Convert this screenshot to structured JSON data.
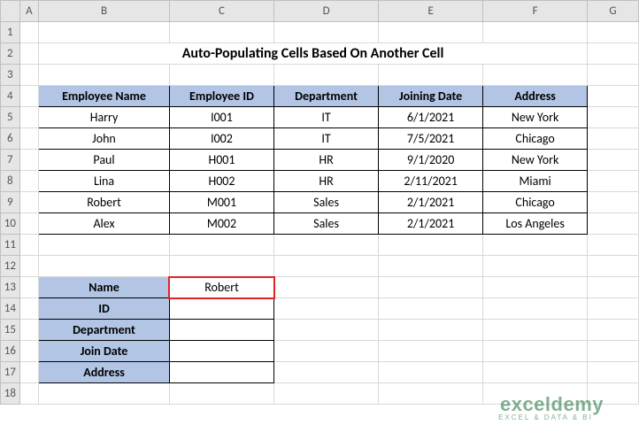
{
  "columns": [
    "A",
    "B",
    "C",
    "D",
    "E",
    "F",
    "G"
  ],
  "rows": [
    "1",
    "2",
    "3",
    "4",
    "5",
    "6",
    "7",
    "8",
    "9",
    "10",
    "11",
    "12",
    "13",
    "14",
    "15",
    "16",
    "17",
    "18"
  ],
  "title": "Auto-Populating Cells Based On Another Cell",
  "table": {
    "headers": [
      "Employee Name",
      "Employee ID",
      "Department",
      "Joining Date",
      "Address"
    ],
    "rows": [
      [
        "Harry",
        "I001",
        "IT",
        "6/1/2021",
        "New York"
      ],
      [
        "John",
        "I002",
        "IT",
        "7/5/2021",
        "Chicago"
      ],
      [
        "Paul",
        "H001",
        "HR",
        "9/1/2020",
        "New York"
      ],
      [
        "Lina",
        "H002",
        "HR",
        "2/11/2021",
        "Miami"
      ],
      [
        "Robert",
        "M001",
        "Sales",
        "2/1/2021",
        "Chicago"
      ],
      [
        "Alex",
        "M002",
        "Sales",
        "2/1/2021",
        "Los Angeles"
      ]
    ]
  },
  "lookup": {
    "labels": [
      "Name",
      "ID",
      "Department",
      "Join Date",
      "Address"
    ],
    "values": [
      "Robert",
      "",
      "",
      "",
      ""
    ]
  },
  "watermark": {
    "brand": "exceldemy",
    "tagline": "EXCEL & DATA & BI"
  },
  "chart_data": {
    "type": "table",
    "title": "Auto-Populating Cells Based On Another Cell",
    "headers": [
      "Employee Name",
      "Employee ID",
      "Department",
      "Joining Date",
      "Address"
    ],
    "rows": [
      [
        "Harry",
        "I001",
        "IT",
        "6/1/2021",
        "New York"
      ],
      [
        "John",
        "I002",
        "IT",
        "7/5/2021",
        "Chicago"
      ],
      [
        "Paul",
        "H001",
        "HR",
        "9/1/2020",
        "New York"
      ],
      [
        "Lina",
        "H002",
        "HR",
        "2/11/2021",
        "Miami"
      ],
      [
        "Robert",
        "M001",
        "Sales",
        "2/1/2021",
        "Chicago"
      ],
      [
        "Alex",
        "M002",
        "Sales",
        "2/1/2021",
        "Los Angeles"
      ]
    ]
  }
}
